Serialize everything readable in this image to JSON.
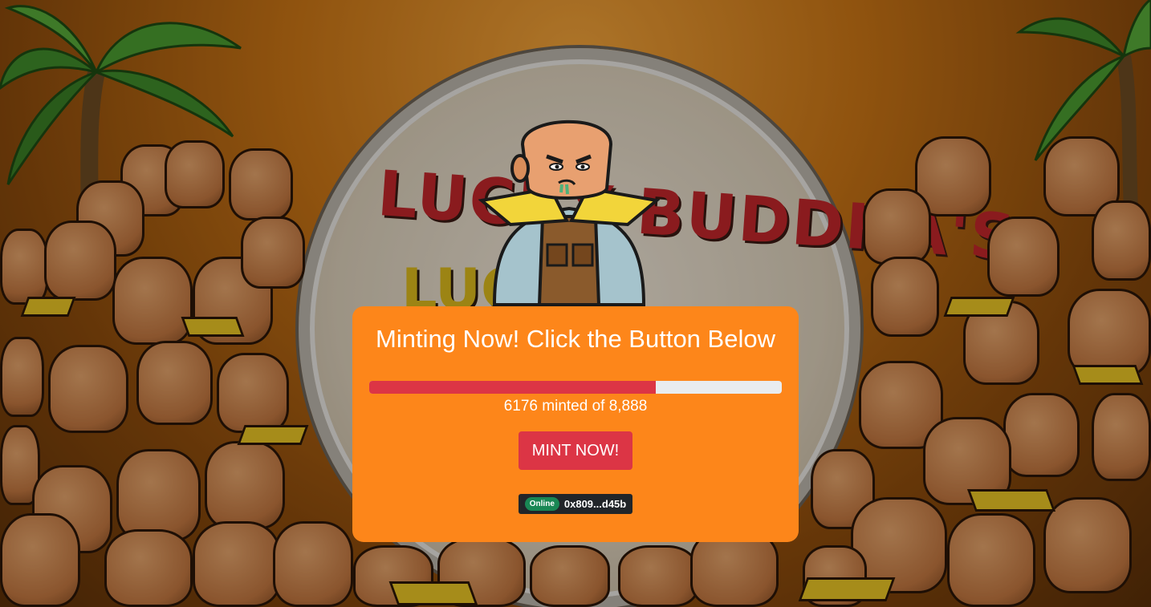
{
  "background": {
    "drum_text_line1": "LUCKY BUDDHA'S",
    "drum_text_line2": "LUCKY"
  },
  "card": {
    "title": "Minting Now! Click the Button Below",
    "progress": {
      "minted": 6176,
      "total": 8888,
      "fraction": 0.6949
    },
    "minted_text": "6176 minted of 8,888",
    "mint_button_label": "MINT NOW!",
    "wallet": {
      "status_badge": "Online",
      "address": "0x809...d45b"
    }
  },
  "colors": {
    "card_bg": "#fd861a",
    "progress_fill": "#dc3545",
    "progress_track": "#e9ecef",
    "button_bg": "#dc3545",
    "wallet_bg": "#212529",
    "badge_bg": "#198754"
  }
}
